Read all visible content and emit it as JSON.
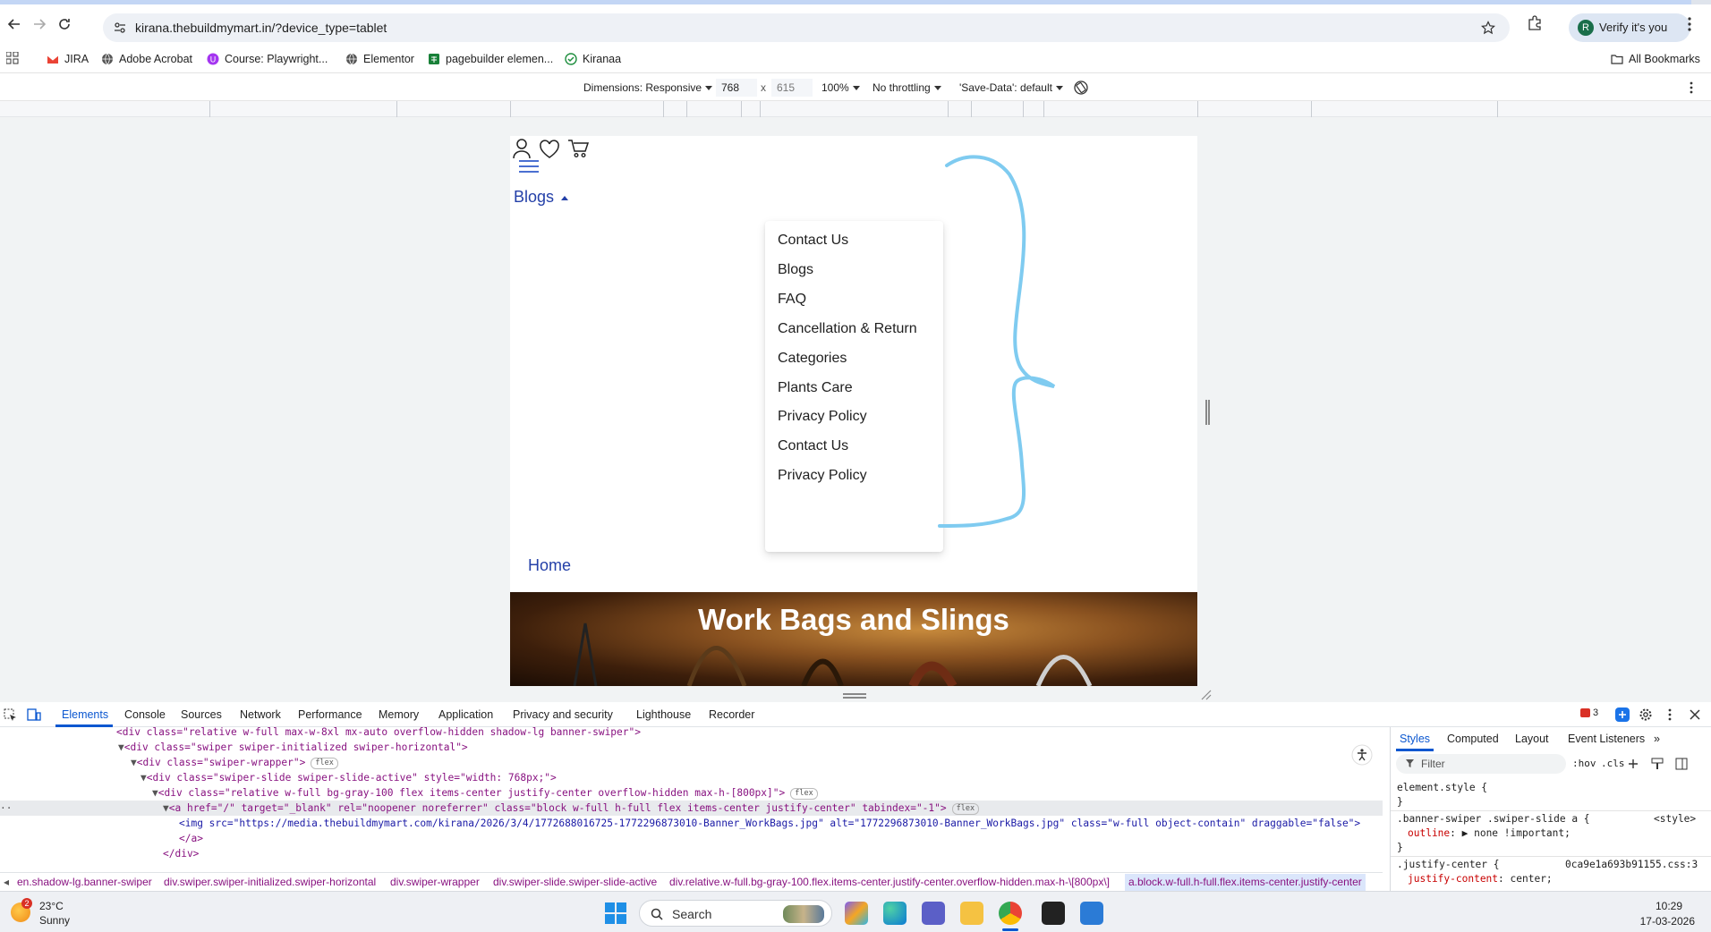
{
  "browser": {
    "url": "kirana.thebuildmymart.in/?device_type=tablet",
    "profile_initial": "R",
    "profile_label": "Verify it's you"
  },
  "bookmarks": {
    "items": [
      {
        "label": "JIRA",
        "icon": "gmail-icon"
      },
      {
        "label": "Adobe Acrobat",
        "icon": "globe-icon"
      },
      {
        "label": "Course: Playwright...",
        "icon": "course-icon"
      },
      {
        "label": "Elementor",
        "icon": "globe-icon"
      },
      {
        "label": "pagebuilder elemen...",
        "icon": "sheets-icon"
      },
      {
        "label": "Kiranaa",
        "icon": "check-icon"
      }
    ],
    "all_bookmarks": "All Bookmarks"
  },
  "device_toolbar": {
    "dimensions_label": "Dimensions: Responsive",
    "width": "768",
    "x": "x",
    "height": "615",
    "zoom": "100%",
    "throttling": "No throttling",
    "save_data": "'Save-Data': default"
  },
  "site": {
    "nav_label": "Blogs",
    "dropdown": [
      "Contact Us",
      "Blogs",
      "FAQ",
      "Cancellation & Return",
      "Categories",
      "Plants Care",
      "Privacy Policy",
      "Contact Us",
      "Privacy Policy"
    ],
    "home_label": "Home",
    "banner_title": "Work Bags and Slings"
  },
  "devtools": {
    "tabs": [
      "Elements",
      "Console",
      "Sources",
      "Network",
      "Performance",
      "Memory",
      "Application",
      "Privacy and security",
      "Lighthouse",
      "Recorder"
    ],
    "error_count": "3",
    "code_lines": [
      "<div class=\"relative w-full max-w-8xl mx-auto overflow-hidden shadow-lg banner-swiper\">",
      "<div class=\"swiper swiper-initialized swiper-horizontal\">",
      "<div class=\"swiper-wrapper\">",
      "<div class=\"swiper-slide swiper-slide-active\" style=\"width: 768px;\">",
      "<div class=\"relative w-full     bg-gray-100 flex items-center justify-center overflow-hidden max-h-[800px]\">",
      "<a href=\"/\" target=\"_blank\" rel=\"noopener noreferrer\" class=\"block w-full h-full flex items-center justify-center\" tabindex=\"-1\">",
      "<img src=\"https://media.thebuildmymart.com/kirana/2026/3/4/1772688016725-1772296873010-Banner_WorkBags.jpg\" alt=\"1772296873010-Banner_WorkBags.jpg\" class=\"w-full object-contain\" draggable=\"false\">",
      "</a>",
      "</div>"
    ],
    "pill_flex": "flex",
    "breadcrumbs": [
      "en.shadow-lg.banner-swiper",
      "div.swiper.swiper-initialized.swiper-horizontal",
      "div.swiper-wrapper",
      "div.swiper-slide.swiper-slide-active",
      "div.relative.w-full.bg-gray-100.flex.items-center.justify-center.overflow-hidden.max-h-\\[800px\\]",
      "a.block.w-full.h-full.flex.items-center.justify-center"
    ],
    "styles_tabs": [
      "Styles",
      "Computed",
      "Layout",
      "Event Listeners"
    ],
    "filter_placeholder": "Filter",
    "hov": ":hov",
    "cls": ".cls",
    "rules": {
      "element_style": "element.style {",
      "close1": "}",
      "rule2_selector": ".banner-swiper .swiper-slide a {",
      "rule2_source": "<style>",
      "rule2_prop": "outline",
      "rule2_value": ": ▶ none !important;",
      "close2": "}",
      "rule3_selector": ".justify-center {",
      "rule3_source": "0ca9e1a693b91155.css:3",
      "rule3_prop": "justify-content",
      "rule3_value": ": center;"
    }
  },
  "taskbar": {
    "weather_badge": "2",
    "temp": "23°C",
    "condition": "Sunny",
    "search_label": "Search",
    "time": "10:29",
    "date": "17-03-2026"
  },
  "colors": {
    "link_blue": "#2440a8",
    "devtools_accent": "#0b57d0",
    "annotation": "#7fcbf0"
  }
}
